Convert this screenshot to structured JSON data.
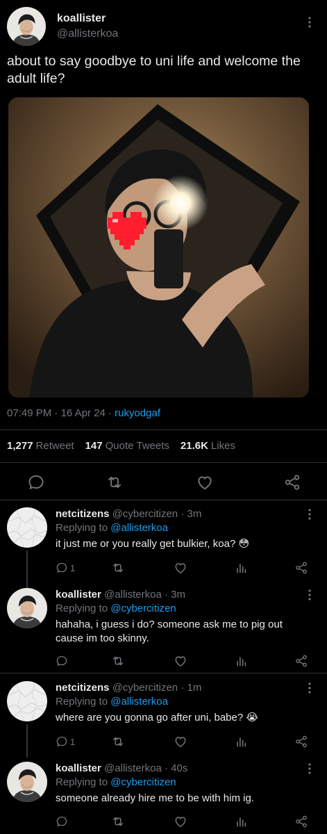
{
  "main_tweet": {
    "author": {
      "display_name": "koallister",
      "handle": "@allisterkoa"
    },
    "text": "about to say goodbye to uni life and welcome the adult life?",
    "time": "07:49 PM",
    "separator": " · ",
    "date": "16 Apr 24",
    "source": "rukyodgaf",
    "stats": {
      "retweets": {
        "count": "1,277",
        "label": "Retweet"
      },
      "quotes": {
        "count": "147",
        "label": "Quote Tweets"
      },
      "likes": {
        "count": "21.6K",
        "label": "Likes"
      }
    },
    "icons": [
      "reply-icon",
      "retweet-icon",
      "like-icon",
      "share-icon",
      "more-icon"
    ]
  },
  "replies": [
    {
      "display_name": "netcitizens",
      "handle": "@cybercitizen",
      "time": "· 3m",
      "replying_prefix": "Replying to ",
      "replying_to": "@allisterkoa",
      "text": "it just me or you really get bulkier, koa? 😳",
      "reply_count": "1",
      "avatar": "crumpled-paper"
    },
    {
      "display_name": "koallister",
      "handle": "@allisterkoa",
      "time": "· 3m",
      "replying_prefix": "Replying to ",
      "replying_to": "@cybercitizen",
      "text": "hahaha, i guess i do? someone ask me to pig out cause im too skinny.",
      "reply_count": "",
      "avatar": "profile-photo"
    },
    {
      "display_name": "netcitizens",
      "handle": "@cybercitizen",
      "time": "· 1m",
      "replying_prefix": "Replying to ",
      "replying_to": "@allisterkoa",
      "text": "where are you gonna go after uni, babe? 😭",
      "reply_count": "1",
      "avatar": "crumpled-paper"
    },
    {
      "display_name": "koallister",
      "handle": "@allisterkoa",
      "time": "· 40s",
      "replying_prefix": "Replying to ",
      "replying_to": "@cybercitizen",
      "text": "someone already hire me to be with him ig.",
      "reply_count": "",
      "avatar": "profile-photo"
    }
  ],
  "colors": {
    "background": "#000000",
    "text": "#e7e9ea",
    "muted": "#71767b",
    "link": "#1d9bf0",
    "divider": "#2f3336"
  }
}
